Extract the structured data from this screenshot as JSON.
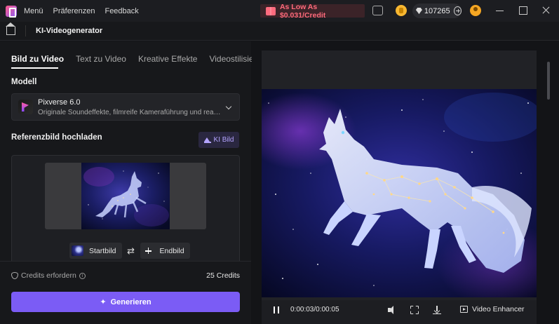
{
  "titlebar": {
    "menu": [
      "Menü",
      "Präferenzen",
      "Feedback"
    ],
    "promo": "As Low As $0.031/Credit",
    "credit_balance": "107265"
  },
  "subheader": {
    "title": "KI-Videogenerator"
  },
  "left": {
    "tabs": [
      "Bild zu Video",
      "Text zu Video",
      "Kreative Effekte",
      "Videostilisierung"
    ],
    "model_section": "Modell",
    "model": {
      "name": "Pixverse 6.0",
      "description": "Originale Soundeffekte, filmreife Kameraführung und realistische"
    },
    "upload_section": "Referenzbild hochladen",
    "ki_bild": "KI Bild",
    "start_frame": "Startbild",
    "end_frame": "Endbild",
    "credits_label": "Credits erfordern",
    "credits_value": "25 Credits",
    "generate": "Generieren"
  },
  "player": {
    "time": "0:00:03/0:00:05",
    "progress": 0.6,
    "enhancer": "Video Enhancer"
  },
  "colors": {
    "accent": "#7b5cf5",
    "promo": "#ff6a7b"
  },
  "icons": [
    "app-logo-icon",
    "feedback-icon",
    "coin-icon",
    "diamond-icon",
    "plus-icon",
    "avatar",
    "home-icon",
    "chevron-down-icon",
    "image-icon",
    "swap-icon",
    "shield-icon",
    "info-icon",
    "sparkle-icon",
    "pause-icon",
    "volume-icon",
    "fullscreen-icon",
    "download-icon",
    "enhancer-icon"
  ]
}
